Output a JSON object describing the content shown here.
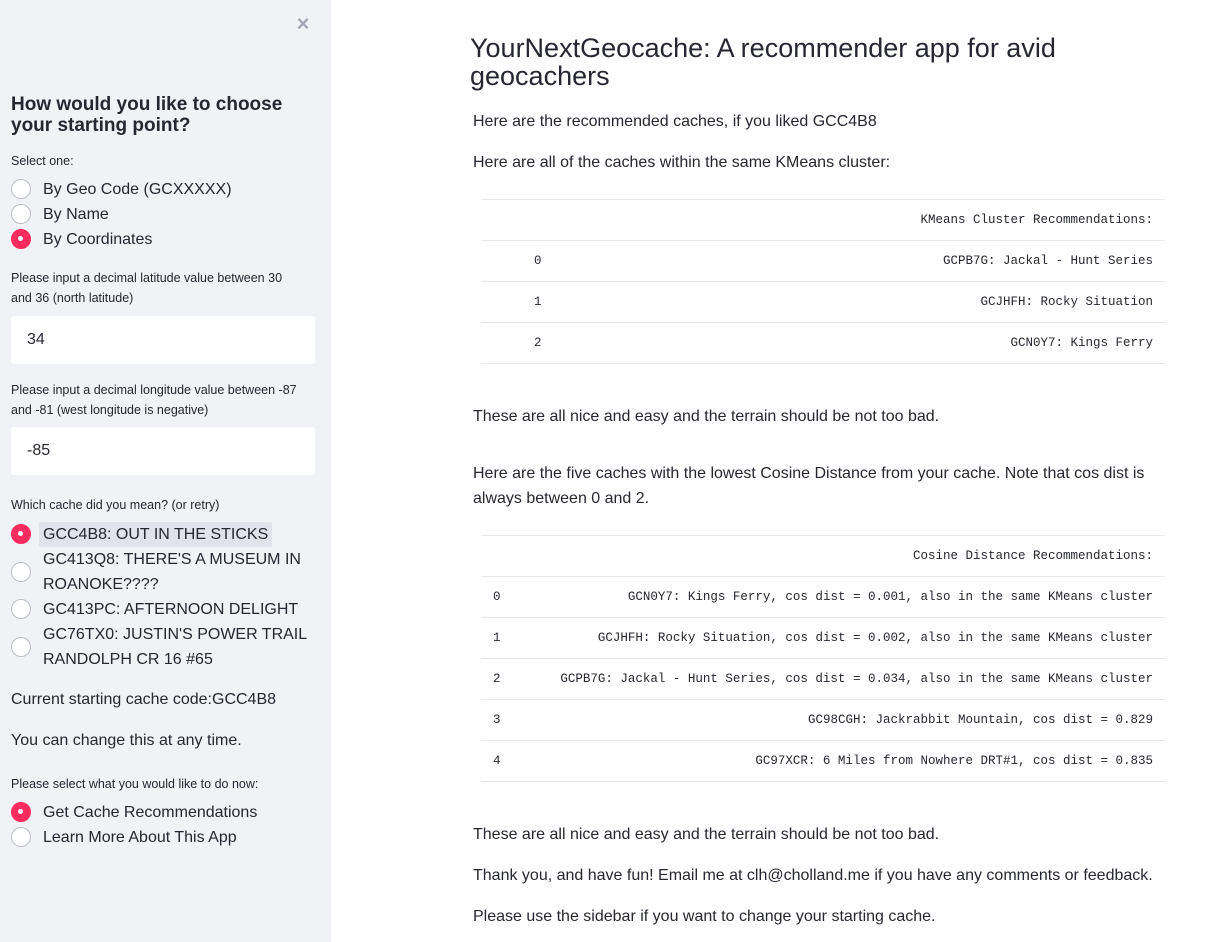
{
  "sidebar": {
    "close_icon": "×",
    "heading": "How would you like to choose your starting point?",
    "select_label": "Select one:",
    "choose_options": [
      "By Geo Code (GCXXXXX)",
      "By Name",
      "By Coordinates"
    ],
    "latitude_label": "Please input a decimal latitude value between 30 and 36 (north latitude)",
    "latitude_value": "34",
    "longitude_label": "Please input a decimal longitude value between -87 and -81 (west longitude is negative)",
    "longitude_value": "-85",
    "cache_label": "Which cache did you mean? (or retry)",
    "cache_options": [
      "GCC4B8: OUT IN THE STICKS",
      "GC413Q8: THERE'S A MUSEUM IN ROANOKE????",
      "GC413PC: AFTERNOON DELIGHT",
      "GC76TX0: JUSTIN'S POWER TRAIL RANDOLPH CR 16 #65"
    ],
    "current_cache": "Current starting cache code:GCC4B8",
    "change_note": "You can change this at any time.",
    "action_label": "Please select what you would like to do now:",
    "action_options": [
      "Get Cache Recommendations",
      "Learn More About This App"
    ],
    "accent_color": "#ff2b5e"
  },
  "main": {
    "title": "YourNextGeocache: A recommender app for avid geocachers",
    "intro": "Here are the recommended caches, if you liked GCC4B8",
    "kmeans_intro": "Here are all of the caches within the same KMeans cluster:",
    "kmeans_table": {
      "header": "KMeans Cluster Recommendations:",
      "rows": [
        {
          "idx": "0",
          "val": "GCPB7G: Jackal - Hunt Series"
        },
        {
          "idx": "1",
          "val": "GCJHFH: Rocky Situation"
        },
        {
          "idx": "2",
          "val": "GCN0Y7: Kings Ferry"
        }
      ]
    },
    "kmeans_note": "These are all nice and easy and the terrain should be not too bad.",
    "cosine_intro": "Here are the five caches with the lowest Cosine Distance from your cache. Note that cos dist is always between 0 and 2.",
    "cosine_table": {
      "header": "Cosine Distance Recommendations:",
      "rows": [
        {
          "idx": "0",
          "val": "GCN0Y7: Kings Ferry, cos dist = 0.001, also in the same KMeans cluster"
        },
        {
          "idx": "1",
          "val": "GCJHFH: Rocky Situation, cos dist = 0.002, also in the same KMeans cluster"
        },
        {
          "idx": "2",
          "val": "GCPB7G: Jackal - Hunt Series, cos dist = 0.034, also in the same KMeans cluster"
        },
        {
          "idx": "3",
          "val": "GC98CGH: Jackrabbit Mountain, cos dist = 0.829"
        },
        {
          "idx": "4",
          "val": "GC97XCR: 6 Miles from Nowhere DRT#1, cos dist = 0.835"
        }
      ]
    },
    "cosine_note": "These are all nice and easy and the terrain should be not too bad.",
    "thanks": "Thank you, and have fun! Email me at clh@cholland.me if you have any comments or feedback.",
    "sidebar_note": "Please use the sidebar if you want to change your starting cache."
  }
}
